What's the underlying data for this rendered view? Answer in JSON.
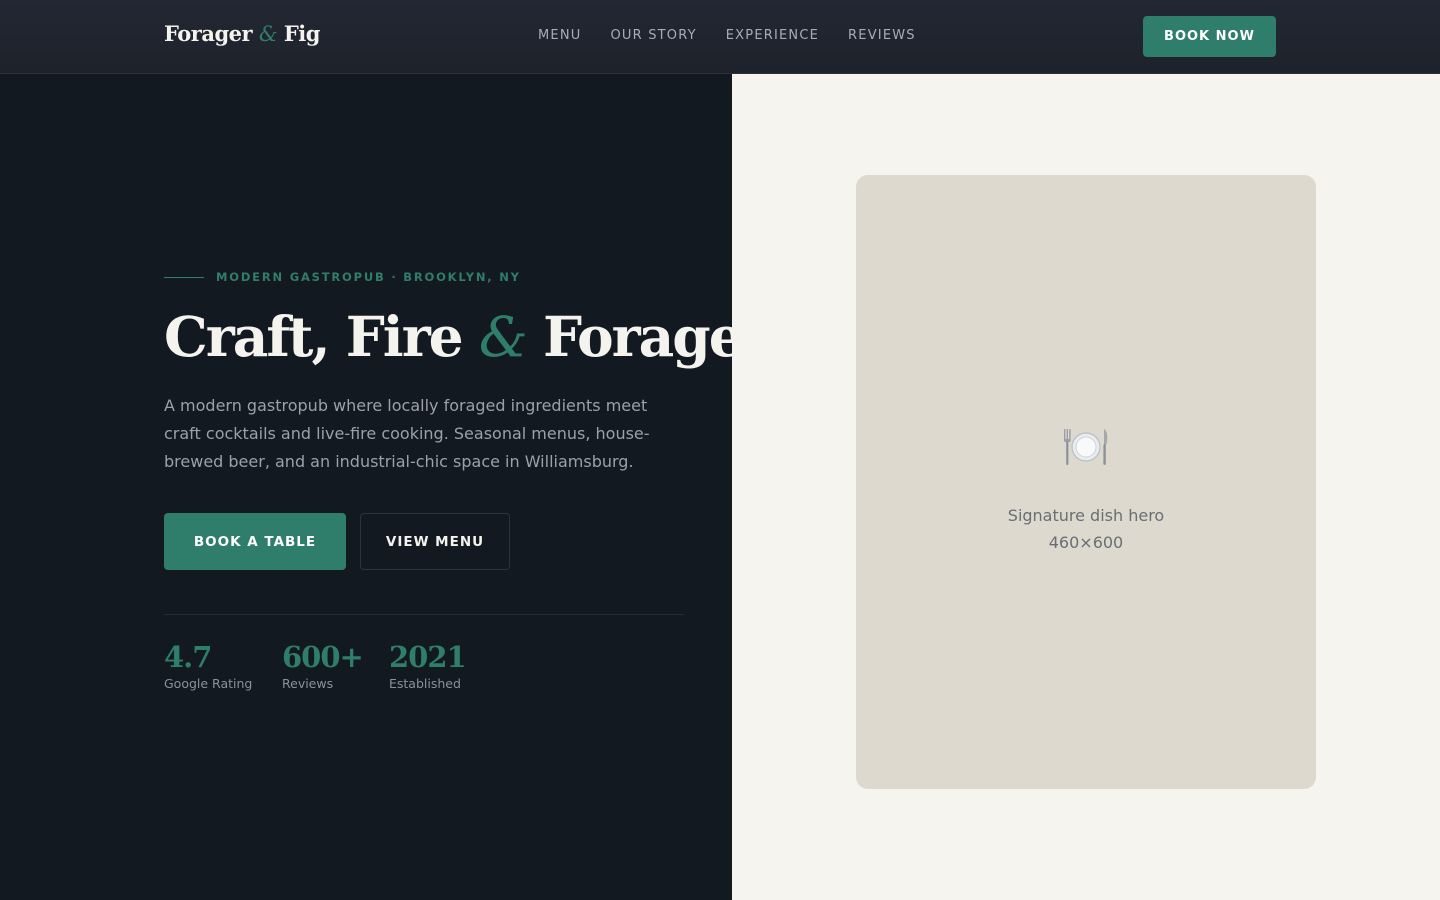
{
  "brand": {
    "name_part1": "Forager",
    "ampersand": "&",
    "name_part2": "Fig"
  },
  "nav": {
    "links": [
      "MENU",
      "OUR STORY",
      "EXPERIENCE",
      "REVIEWS"
    ],
    "cta": "BOOK NOW"
  },
  "hero": {
    "eyebrow": "MODERN GASTROPUB · BROOKLYN, NY",
    "headline_part1": "Craft, Fire",
    "headline_amp": "&",
    "headline_part2": "Forage",
    "intro": "A modern gastropub where locally foraged ingredients meet craft cocktails and live-fire cooking. Seasonal menus, house-brewed beer, and an industrial-chic space in Williamsburg.",
    "primary_button": "BOOK A TABLE",
    "secondary_button": "VIEW MENU"
  },
  "stats": [
    {
      "value": "4.7",
      "label": "Google Rating"
    },
    {
      "value": "600+",
      "label": "Reviews"
    },
    {
      "value": "2021",
      "label": "Established"
    }
  ],
  "image_placeholder": {
    "icon": "plate-with-cutlery-icon",
    "caption_line1": "Signature dish hero",
    "caption_line2": "460×600"
  },
  "colors": {
    "accent": "#2f7d6b",
    "left_panel_bg": "#131920",
    "right_panel_bg": "#f5f4ef",
    "placeholder_bg": "#ddd9ce"
  }
}
